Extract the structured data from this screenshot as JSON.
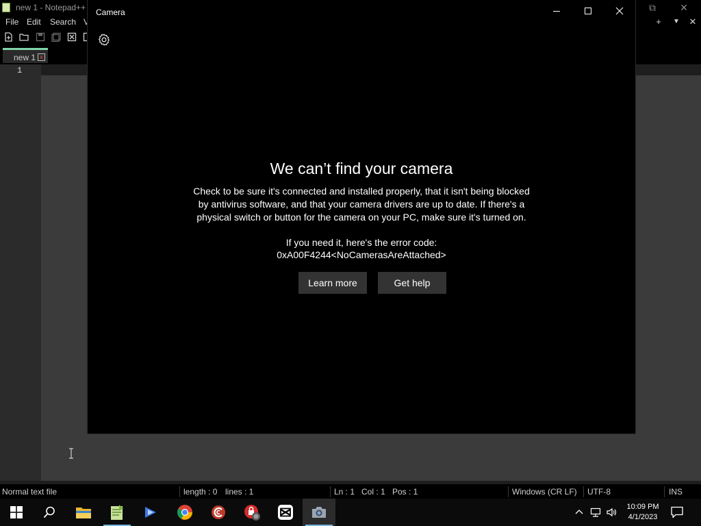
{
  "notepad": {
    "title": "new 1 - Notepad++",
    "window_controls": {
      "restore": "⧉",
      "close": "✕"
    },
    "menu": [
      "File",
      "Edit",
      "Search",
      "V"
    ],
    "menu_controls": {
      "add": "+",
      "dropdown": "▼",
      "close": "✕"
    },
    "tab": {
      "label": "new 1",
      "close": "x"
    },
    "line_number": "1",
    "status": {
      "file_type": "Normal text file",
      "length": "length : 0",
      "lines": "lines : 1",
      "ln": "Ln : 1",
      "col": "Col : 1",
      "pos": "Pos : 1",
      "eol": "Windows (CR LF)",
      "encoding": "UTF-8",
      "mode": "INS"
    }
  },
  "camera": {
    "title": "Camera",
    "heading": "We can’t find your camera",
    "body": "Check to be sure it's connected and installed properly, that it isn't being blocked by antivirus software, and that your camera drivers are up to date. If there's a physical switch or button for the camera on your PC, make sure it's turned on.",
    "error_label": "If you need it, here's the error code:",
    "error_code": "0xA00F4244<NoCamerasAreAttached>",
    "buttons": {
      "learn_more": "Learn more",
      "get_help": "Get help"
    },
    "icons": {
      "settings": "gear-icon",
      "minimize": "minimize-icon",
      "maximize": "maximize-icon",
      "close": "close-icon"
    }
  },
  "taskbar": {
    "apps": [
      "start",
      "search",
      "file-explorer",
      "notepad-plus-plus",
      "video-editor",
      "chrome",
      "ccleaner",
      "security-app",
      "capcut",
      "camera"
    ],
    "active_app": "camera",
    "time": "10:09 PM",
    "date": "4/1/2023"
  },
  "colors": {
    "camera_bg": "#000000",
    "button_bg": "#333333",
    "editor_bg": "#3b3b3b",
    "tab_accent": "#7fd4a8",
    "taskbar_bg": "#0b0b0b"
  }
}
